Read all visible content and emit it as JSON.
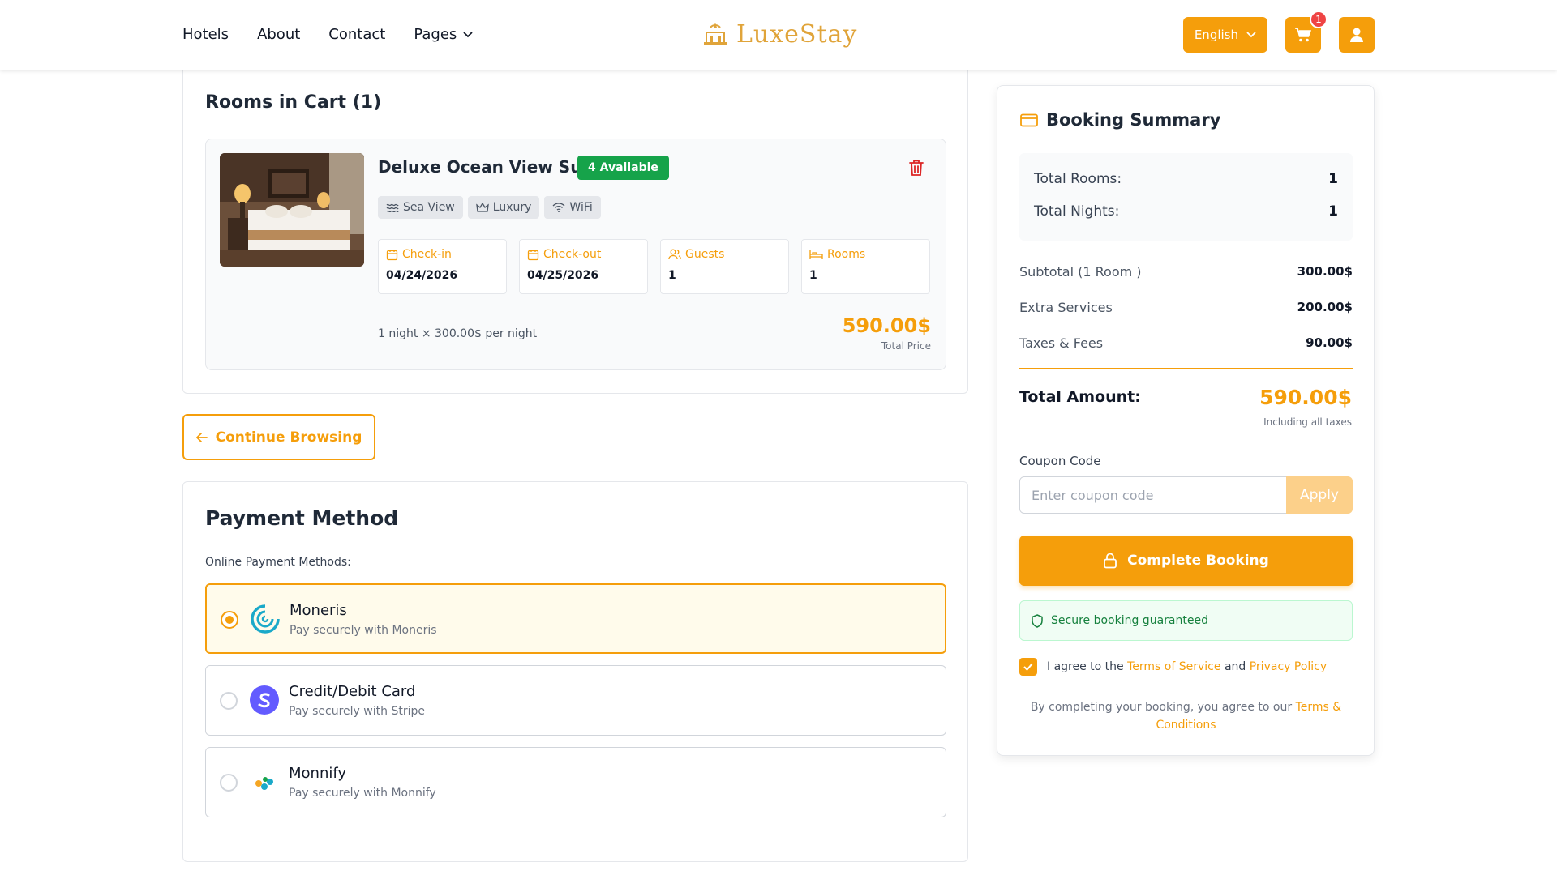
{
  "header": {
    "nav": [
      "Hotels",
      "About",
      "Contact",
      "Pages"
    ],
    "logo": "LuxeStay",
    "language": "English",
    "cart_count": "1"
  },
  "cart": {
    "title": "Rooms in Cart (1)",
    "room": {
      "name": "Deluxe Ocean View Suite",
      "availability": "4 Available",
      "tags": [
        "Sea View",
        "Luxury",
        "WiFi"
      ],
      "details": [
        {
          "label": "Check-in",
          "value": "04/24/2026",
          "icon": "calendar-icon"
        },
        {
          "label": "Check-out",
          "value": "04/25/2026",
          "icon": "calendar-icon"
        },
        {
          "label": "Guests",
          "value": "1",
          "icon": "users-icon"
        },
        {
          "label": "Rooms",
          "value": "1",
          "icon": "bed-icon"
        }
      ],
      "per_night": "1 night × 300.00$ per night",
      "total": "590.00$",
      "total_label": "Total Price"
    }
  },
  "continue_label": "Continue Browsing",
  "payment": {
    "title": "Payment Method",
    "subtitle": "Online Payment Methods:",
    "methods": [
      {
        "name": "Moneris",
        "desc": "Pay securely with Moneris",
        "selected": true
      },
      {
        "name": "Credit/Debit Card",
        "desc": "Pay securely with Stripe",
        "selected": false
      },
      {
        "name": "Monnify",
        "desc": "Pay securely with Monnify",
        "selected": false
      }
    ]
  },
  "summary": {
    "title": "Booking Summary",
    "total_rooms_label": "Total Rooms:",
    "total_rooms": "1",
    "total_nights_label": "Total Nights:",
    "total_nights": "1",
    "lines": [
      {
        "label": "Subtotal (1 Room )",
        "value": "300.00$"
      },
      {
        "label": "Extra Services",
        "value": "200.00$"
      },
      {
        "label": "Taxes & Fees",
        "value": "90.00$"
      }
    ],
    "total_label": "Total Amount:",
    "total": "590.00$",
    "total_note": "Including all taxes",
    "coupon_label": "Coupon Code",
    "coupon_placeholder": "Enter coupon code",
    "apply_label": "Apply",
    "book_label": "Complete Booking",
    "secure_text": "Secure booking guaranteed",
    "agree_prefix": "I agree to the",
    "terms_link": "Terms of Service",
    "and": "and",
    "privacy_link": "Privacy Policy",
    "legal_prefix": "By completing your booking, you agree to our",
    "legal_link": "Terms & Conditions"
  },
  "colors": {
    "accent": "#f59e0b",
    "success": "#16a34a",
    "danger": "#ef4444"
  }
}
